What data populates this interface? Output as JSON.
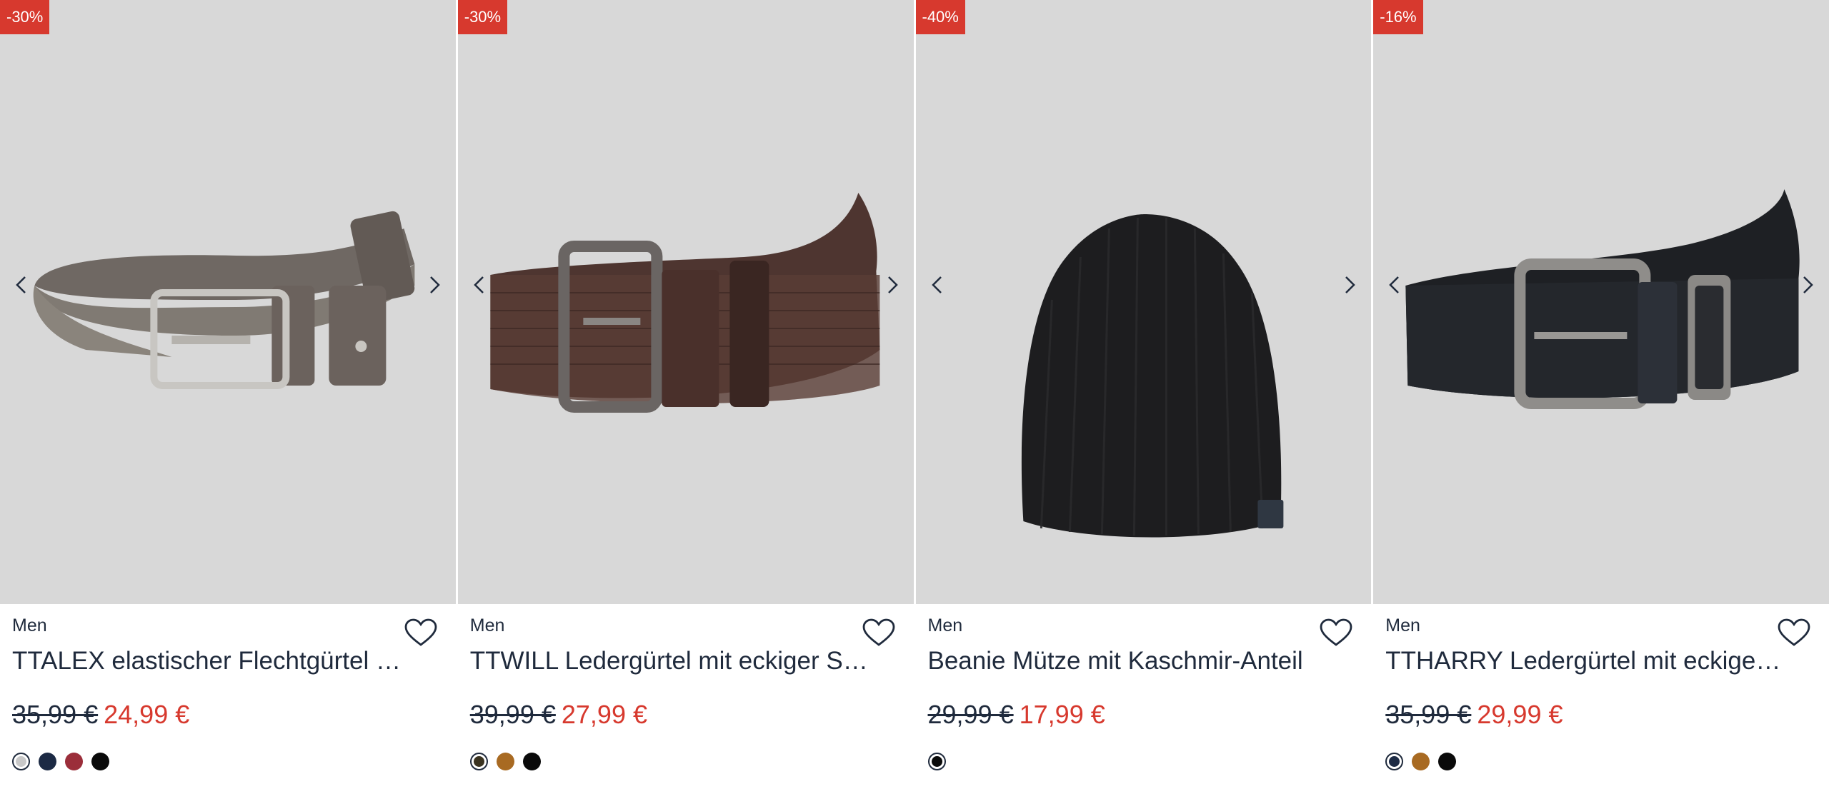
{
  "products": [
    {
      "discount": "-30%",
      "category": "Men",
      "title": "TTALEX elastischer Flechtgürtel mit Lederdetails",
      "old_price": "35,99 €",
      "new_price": "24,99 €",
      "swatches": [
        "#c8c8c8",
        "#1c2a44",
        "#9b2e3a",
        "#0a0a0a"
      ],
      "selected_swatch": 0,
      "image": "grey-braided-belt"
    },
    {
      "discount": "-30%",
      "category": "Men",
      "title": "TTWILL Ledergürtel mit eckiger Schnalle",
      "old_price": "39,99 €",
      "new_price": "27,99 €",
      "swatches": [
        "#3a3320",
        "#a86a22",
        "#0a0a0a"
      ],
      "selected_swatch": 0,
      "image": "brown-leather-belt"
    },
    {
      "discount": "-40%",
      "category": "Men",
      "title": "Beanie Mütze mit Kaschmir-Anteil",
      "old_price": "29,99 €",
      "new_price": "17,99 €",
      "swatches": [
        "#0a0a0a"
      ],
      "selected_swatch": 0,
      "image": "black-beanie"
    },
    {
      "discount": "-16%",
      "category": "Men",
      "title": "TTHARRY Ledergürtel mit eckiger Schnalle",
      "old_price": "35,99 €",
      "new_price": "29,99 €",
      "swatches": [
        "#1c2a44",
        "#a86a22",
        "#0a0a0a"
      ],
      "selected_swatch": 0,
      "image": "black-leather-belt"
    }
  ],
  "colors": {
    "accent": "#d7392e",
    "text": "#1f2a3c",
    "image_bg": "#d8d8d8"
  }
}
